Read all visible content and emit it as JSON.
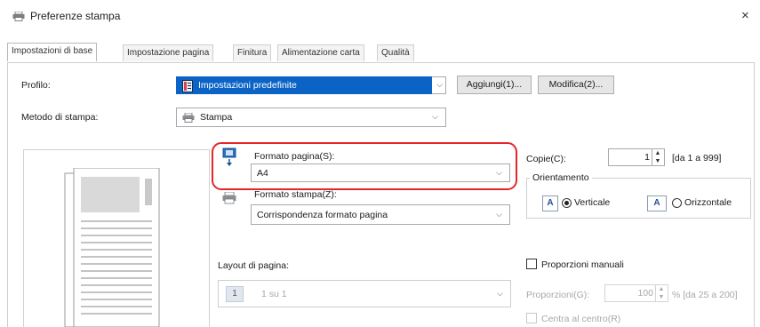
{
  "window": {
    "title": "Preferenze stampa",
    "close_label": "×"
  },
  "tabs": [
    {
      "label": "Impostazioni di base",
      "active": true
    },
    {
      "label": "Impostazione pagina",
      "active": false
    },
    {
      "label": "Finitura",
      "active": false
    },
    {
      "label": "Alimentazione carta",
      "active": false
    },
    {
      "label": "Qualità",
      "active": false
    }
  ],
  "profile": {
    "label": "Profilo:",
    "value": "Impostazioni predefinite",
    "add_button": "Aggiungi(1)...",
    "edit_button": "Modifica(2)..."
  },
  "print_method": {
    "label": "Metodo di stampa:",
    "value": "Stampa"
  },
  "page_size": {
    "label": "Formato pagina(S):",
    "value": "A4"
  },
  "output_size": {
    "label": "Formato stampa(Z):",
    "value": "Corrispondenza formato pagina"
  },
  "copies": {
    "label": "Copie(C):",
    "value": "1",
    "range": "[da 1 a 999]"
  },
  "orientation": {
    "label": "Orientamento",
    "portrait_label": "Verticale",
    "landscape_label": "Orizzontale",
    "portrait_icon": "A",
    "landscape_icon": "A",
    "selected": "portrait"
  },
  "page_layout": {
    "label": "Layout di pagina:",
    "icon_text": "1",
    "value": "1 su 1"
  },
  "manual_scaling": {
    "label": "Proporzioni manuali",
    "checked": false,
    "scaling_label": "Proporzioni(G):",
    "scaling_value": "100",
    "scaling_range": "% [da 25 a 200]",
    "center_label": "Centra al centro(R)"
  },
  "colors": {
    "accent": "#0b63c6",
    "highlight": "#e5262b"
  }
}
